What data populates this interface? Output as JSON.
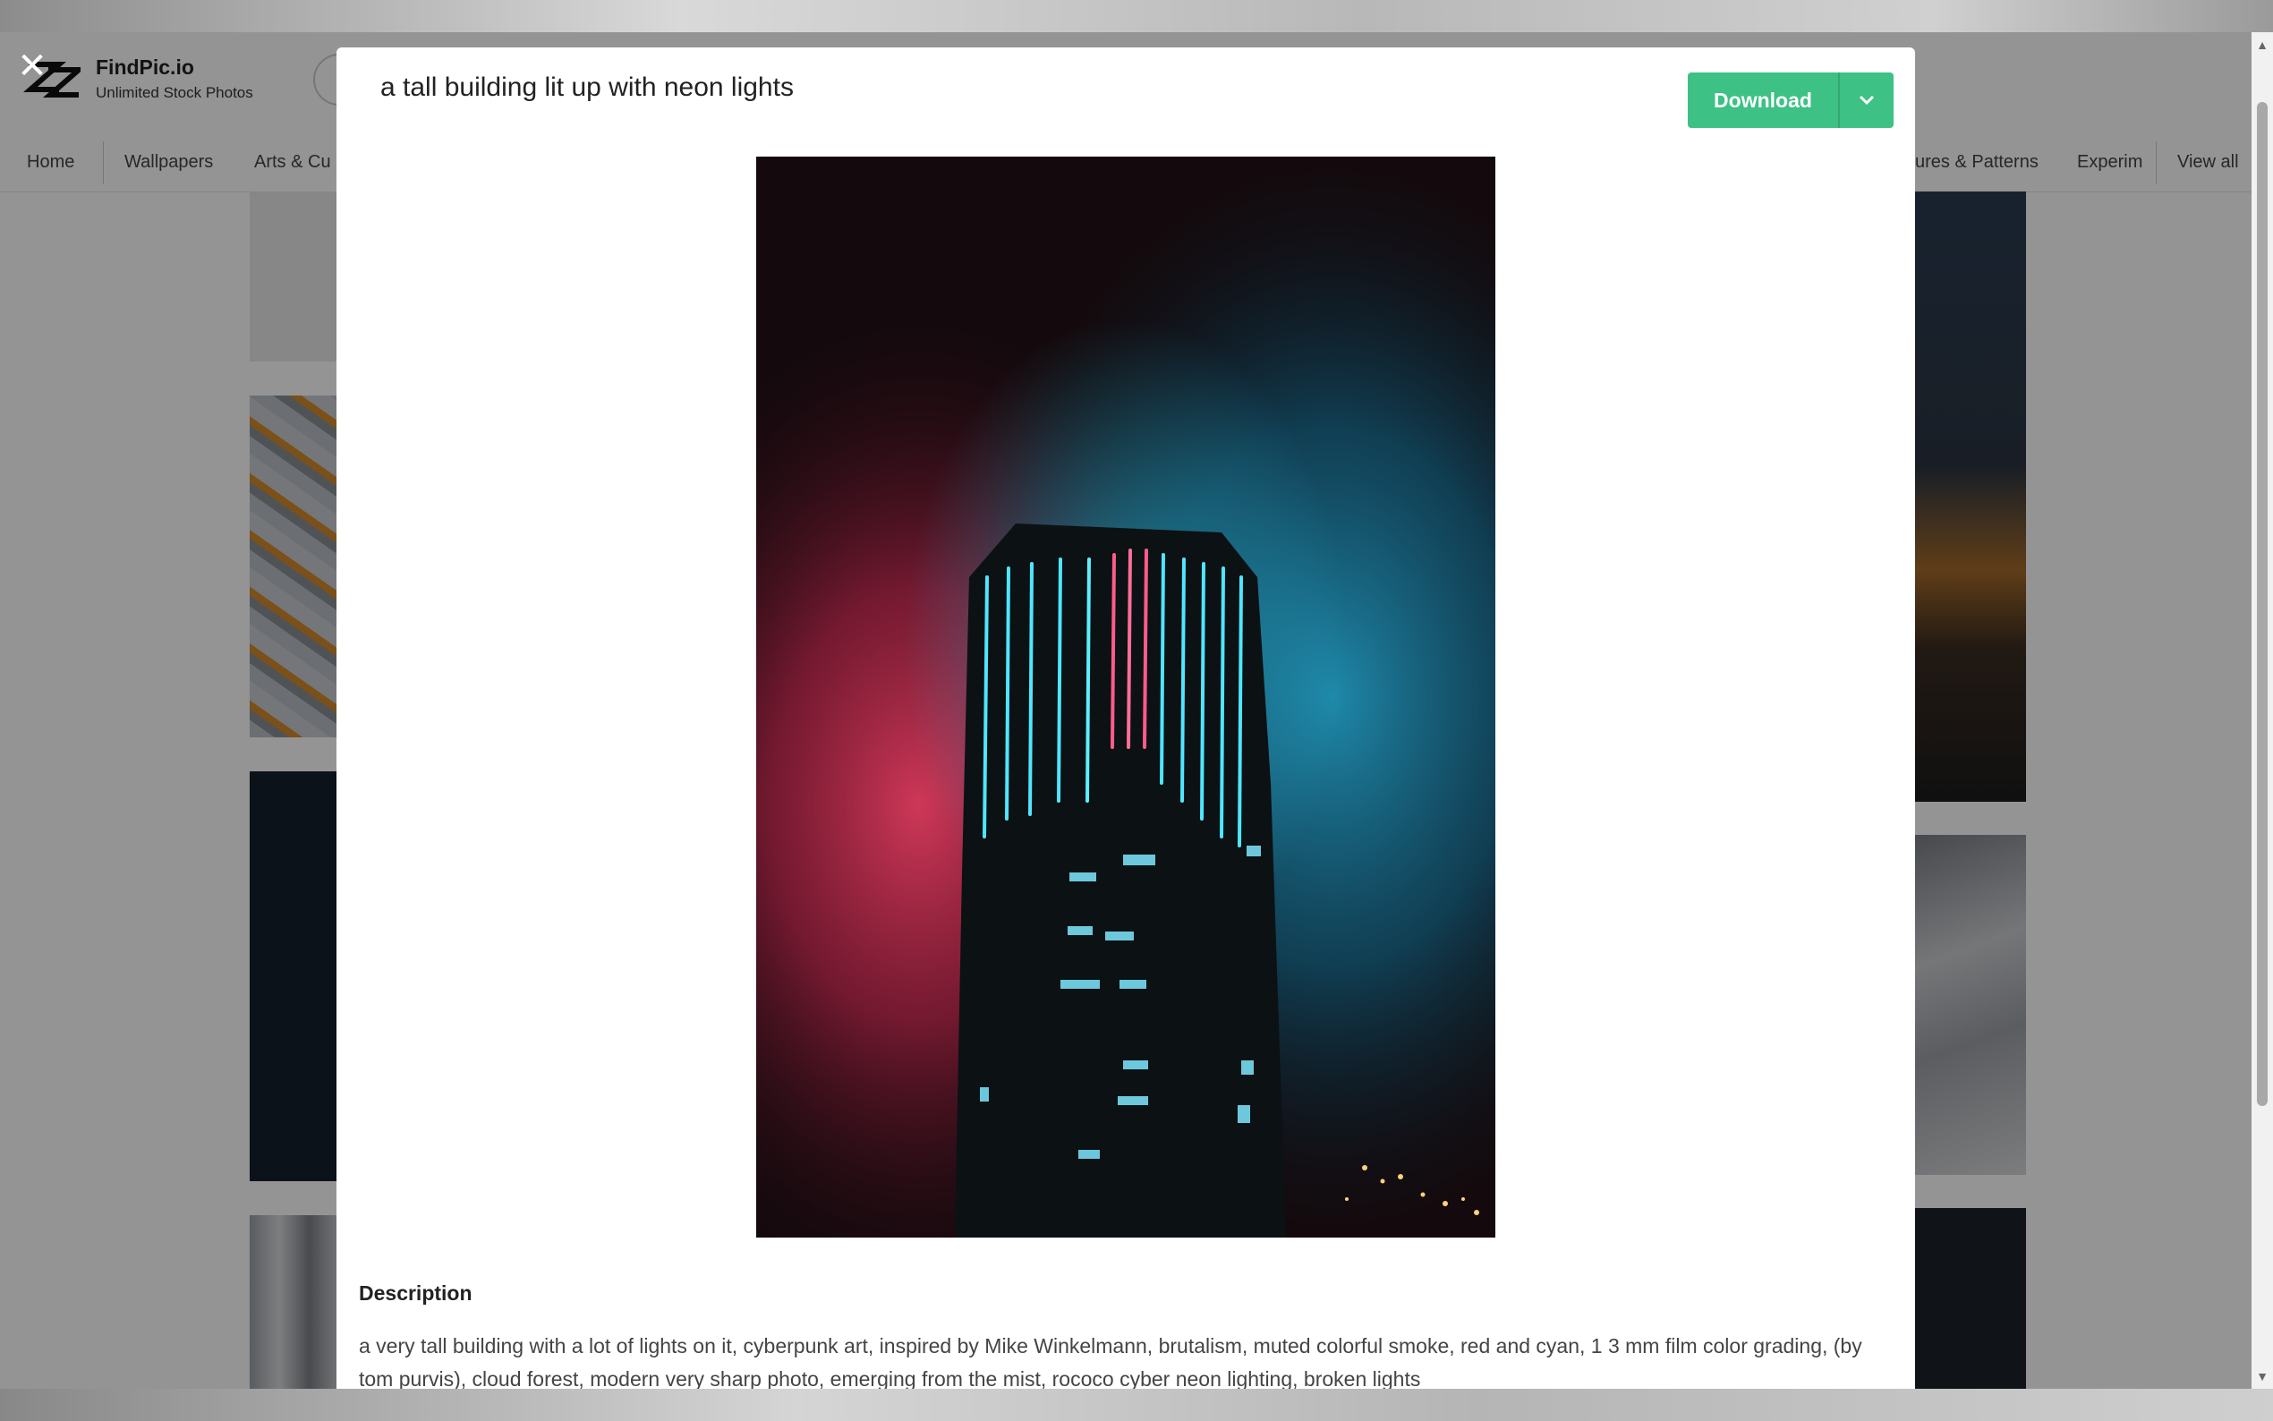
{
  "brand": {
    "name": "FindPic.io",
    "tagline": "Unlimited Stock Photos"
  },
  "nav": {
    "items": [
      "Home",
      "Wallpapers",
      "Arts & Cu",
      "ures & Patterns",
      "Experim",
      "View all"
    ]
  },
  "modal": {
    "title": "a tall building lit up with neon lights",
    "download_label": "Download",
    "description_heading": "Description",
    "description": "a very tall building with a lot of lights on it, cyberpunk art, inspired by Mike Winkelmann, brutalism, muted colorful smoke, red and cyan, 1 3 mm film color grading, (by tom purvis), cloud forest, modern very sharp photo, emerging from the mist, rococo cyber neon lighting, broken lights"
  },
  "colors": {
    "accent": "#3dc184",
    "overlay": "rgba(0,0,0,0.42)"
  },
  "icons": {
    "close": "close-icon",
    "caret": "chevron-down-icon",
    "logo": "findpic-logo-icon"
  }
}
